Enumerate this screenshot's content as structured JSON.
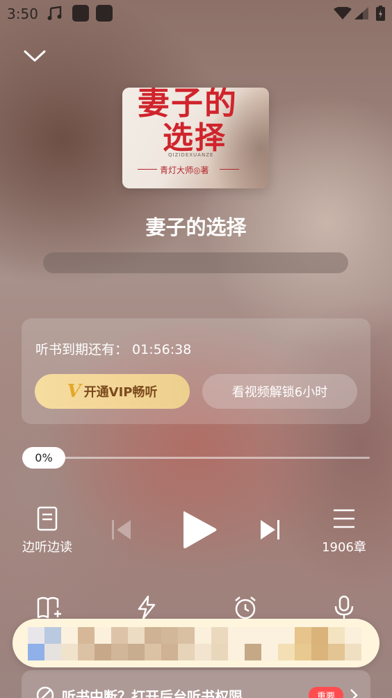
{
  "status_bar": {
    "time": "3:50"
  },
  "book": {
    "title": "妻子的选择",
    "cover": {
      "title_line1": "妻子的",
      "title_line2": "选择",
      "pinyin": "QIZIDEXUANZE",
      "author": "青灯大师◎著"
    }
  },
  "trial": {
    "expiry_label": "听书到期还有：",
    "countdown": "01:56:38",
    "vip_mark": "V",
    "vip_button": "开通VIP畅听",
    "video_button": "看视频解锁6小时"
  },
  "progress": {
    "percent": 0,
    "label": "0%"
  },
  "controls": {
    "read_along_label": "边听边读",
    "chapters_label": "1906章"
  },
  "tools": [
    {
      "icon": "book-add-icon"
    },
    {
      "icon": "speed-icon"
    },
    {
      "icon": "alarm-clock-icon"
    },
    {
      "icon": "microphone-icon"
    }
  ],
  "notice": {
    "text": "听书中断？打开后台听书权限",
    "badge": "重要"
  },
  "colors": {
    "vip_gold": "#f3d596",
    "vip_text": "#7b4a1c",
    "badge_red": "#ff4d4f",
    "cover_red": "#d0242c"
  }
}
